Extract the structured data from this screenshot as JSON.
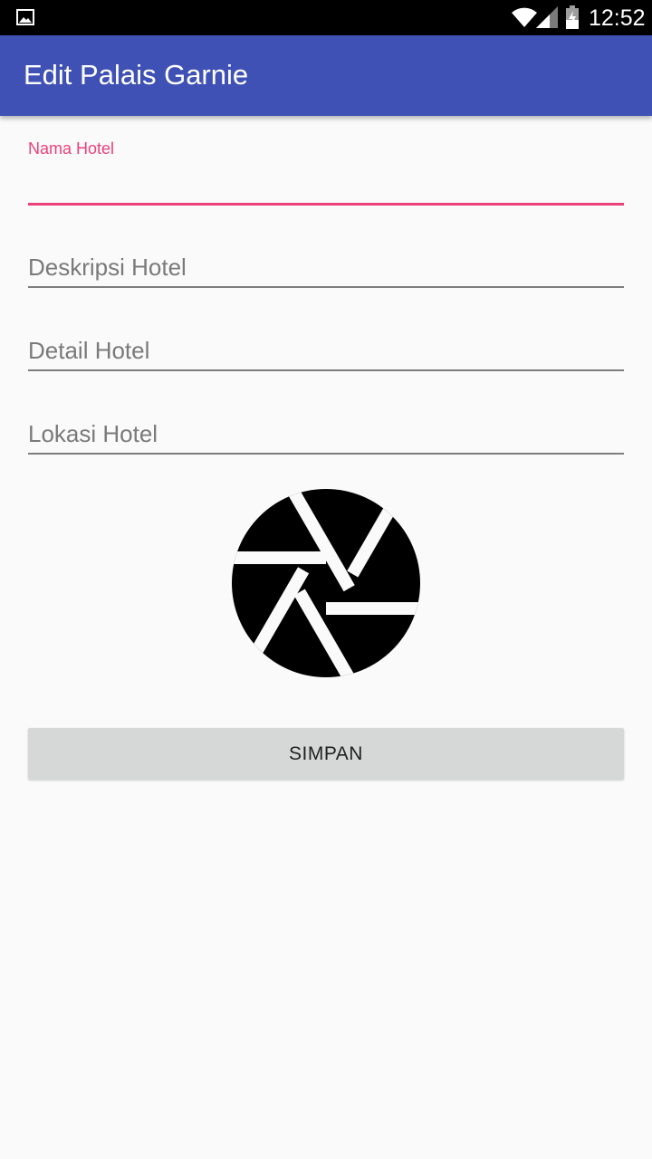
{
  "status_bar": {
    "time": "12:52",
    "icons": [
      "image-icon",
      "wifi-icon",
      "signal-icon",
      "battery-icon"
    ]
  },
  "app_bar": {
    "title": "Edit Palais Garnie",
    "color": "#3f51b5"
  },
  "form": {
    "nama_hotel": {
      "label": "Nama Hotel",
      "value": "",
      "placeholder": ""
    },
    "deskripsi_hotel": {
      "placeholder": "Deskripsi Hotel",
      "value": ""
    },
    "detail_hotel": {
      "placeholder": "Detail Hotel",
      "value": ""
    },
    "lokasi_hotel": {
      "placeholder": "Lokasi Hotel",
      "value": ""
    }
  },
  "image_picker": {
    "icon": "camera-shutter-icon"
  },
  "save_button": {
    "label": "SIMPAN"
  },
  "colors": {
    "accent": "#ec407a",
    "background": "#fafafa",
    "button": "#d6d7d7"
  }
}
